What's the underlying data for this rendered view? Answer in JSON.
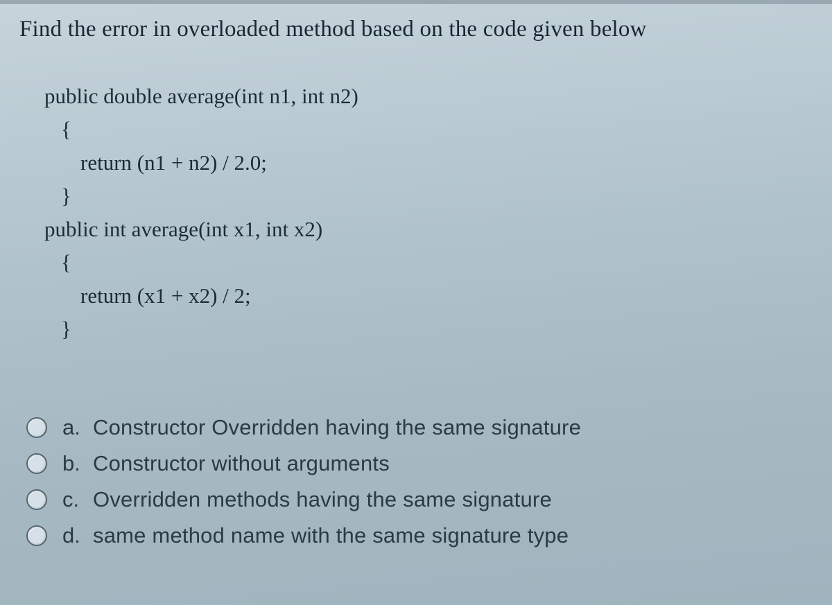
{
  "question": "Find the error in overloaded method based on the code given below",
  "code": {
    "l1": "public double average(int n1, int n2)",
    "l2": "{",
    "l3": "return (n1 + n2) / 2.0;",
    "l4": "}",
    "l5": "public int average(int x1, int x2)",
    "l6": "{",
    "l7": "return (x1 + x2) / 2;",
    "l8": "}"
  },
  "options": [
    {
      "letter": "a.",
      "text": "Constructor Overridden having the same signature"
    },
    {
      "letter": "b.",
      "text": "Constructor without arguments"
    },
    {
      "letter": "c.",
      "text": "Overridden methods having the same signature"
    },
    {
      "letter": "d.",
      "text": "same method name with the same signature type"
    }
  ]
}
